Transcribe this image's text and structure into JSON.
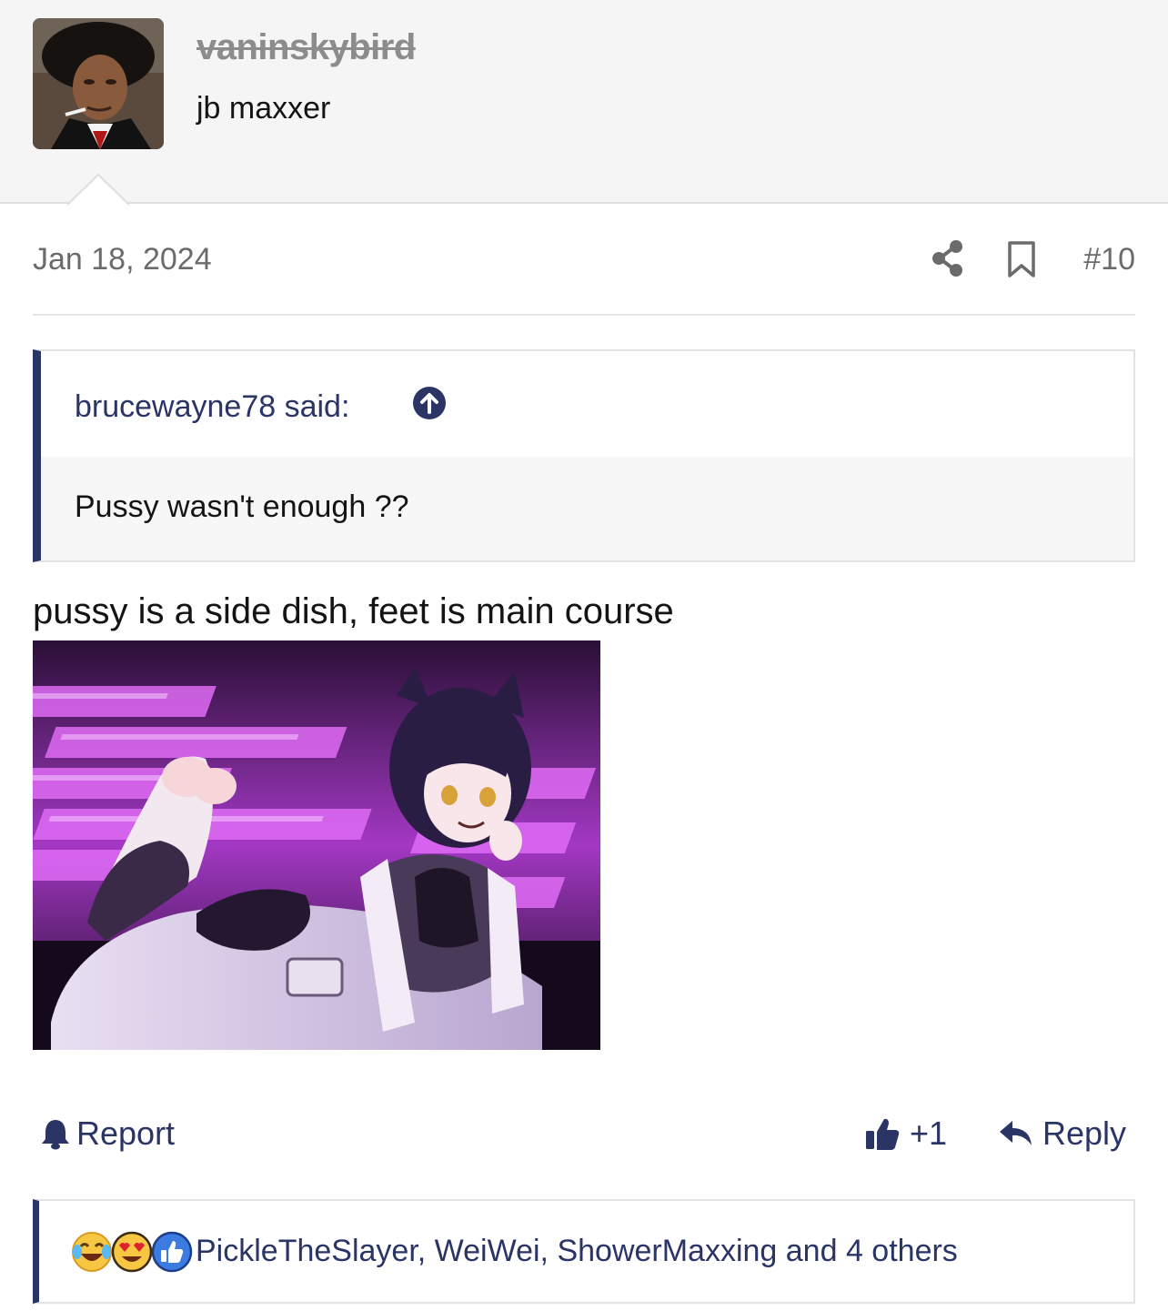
{
  "author": {
    "username": "vaninskybird",
    "user_title": "jb maxxer",
    "avatar_icon": "avatar-photo"
  },
  "post": {
    "date": "Jan 18, 2024",
    "number": "#10",
    "message": "pussy is a side dish, feet is main course",
    "image_alt": "anime illustration"
  },
  "quote": {
    "author_said": "brucewayne78 said:",
    "text": "Pussy wasn't enough ??"
  },
  "actions": {
    "report": "Report",
    "like_count": "+1",
    "reply": "Reply"
  },
  "reactions": {
    "icons": [
      "laugh-cry-icon",
      "heart-eyes-icon",
      "thumbs-up-icon"
    ],
    "users_text": "PickleTheSlayer, WeiWei, ShowerMaxxing and 4 others"
  },
  "colors": {
    "accent": "#2a3566",
    "muted": "#6b6b6b",
    "header_bg": "#f5f5f5"
  }
}
